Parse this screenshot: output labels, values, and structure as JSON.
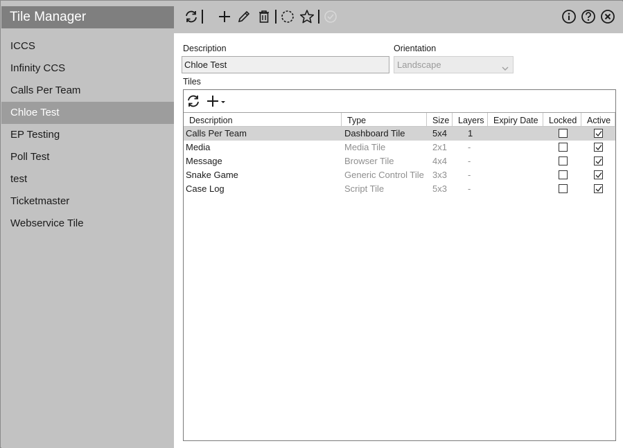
{
  "app": {
    "title": "Tile Manager"
  },
  "sidebar": {
    "items": [
      {
        "label": "ICCS",
        "selected": false
      },
      {
        "label": "Infinity CCS",
        "selected": false
      },
      {
        "label": "Calls Per Team",
        "selected": false
      },
      {
        "label": "Chloe Test",
        "selected": true
      },
      {
        "label": "EP Testing",
        "selected": false
      },
      {
        "label": "Poll Test",
        "selected": false
      },
      {
        "label": "test",
        "selected": false
      },
      {
        "label": "Ticketmaster",
        "selected": false
      },
      {
        "label": "Webservice Tile",
        "selected": false
      }
    ]
  },
  "toolbar": {
    "icons": [
      "refresh-icon",
      "add-icon",
      "edit-icon",
      "delete-icon",
      "circle-dashed-icon",
      "star-icon",
      "check-circle-icon",
      "info-icon",
      "help-icon",
      "close-icon"
    ]
  },
  "form": {
    "description_label": "Description",
    "description_value": "Chloe Test",
    "orientation_label": "Orientation",
    "orientation_value": "Landscape",
    "tiles_label": "Tiles"
  },
  "tiles_table": {
    "columns": [
      "Description",
      "Type",
      "Size",
      "Layers",
      "Expiry Date",
      "Locked",
      "Active"
    ],
    "rows": [
      {
        "description": "Calls Per Team",
        "type": "Dashboard Tile",
        "size": "5x4",
        "layers": "1",
        "expiry": "",
        "locked": false,
        "active": true,
        "selected": true
      },
      {
        "description": "Media",
        "type": "Media Tile",
        "size": "2x1",
        "layers": "-",
        "expiry": "",
        "locked": false,
        "active": true,
        "selected": false
      },
      {
        "description": "Message",
        "type": "Browser Tile",
        "size": "4x4",
        "layers": "-",
        "expiry": "",
        "locked": false,
        "active": true,
        "selected": false
      },
      {
        "description": "Snake Game",
        "type": "Generic Control Tile",
        "size": "3x3",
        "layers": "-",
        "expiry": "",
        "locked": false,
        "active": true,
        "selected": false
      },
      {
        "description": "Case Log",
        "type": "Script Tile",
        "size": "5x3",
        "layers": "-",
        "expiry": "",
        "locked": false,
        "active": true,
        "selected": false
      }
    ]
  },
  "colors": {
    "sidebar_bg": "#c2c2c2",
    "title_bg": "#7f7f7f",
    "selected_bg": "#9d9d9d",
    "row_selected": "#d3d3d3"
  }
}
